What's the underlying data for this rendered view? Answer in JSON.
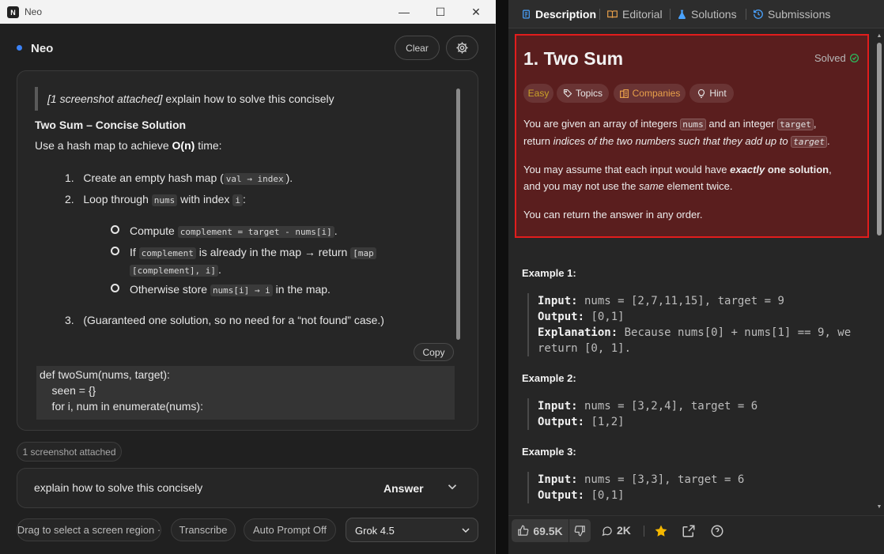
{
  "window": {
    "app_icon_letter": "N",
    "title": "Neo",
    "minimize_glyph": "—",
    "maximize_glyph": "☐",
    "close_glyph": "✕"
  },
  "header": {
    "title": "Neo",
    "clear_label": "Clear",
    "settings_icon": "gear-icon"
  },
  "chat": {
    "prompt_prefix": "[1 screenshot attached]",
    "prompt_text": " explain how to solve this concisely",
    "solution_title": "Two Sum – Concise Solution",
    "intro_pre": "Use a hash map to achieve ",
    "intro_bold": "O(n)",
    "intro_post": " time:",
    "step1_num": "1.",
    "step1_pre": "Create an empty hash map (",
    "step1_code": "val → index",
    "step1_post": ").",
    "step2_num": "2.",
    "step2_pre": "Loop through ",
    "step2_code1": "nums",
    "step2_mid": " with index ",
    "step2_code2": "i",
    "step2_post": ":",
    "sub1_pre": "Compute ",
    "sub1_code": "complement = target - nums[i]",
    "sub1_post": ".",
    "sub2_pre": "If ",
    "sub2_code1": "complement",
    "sub2_mid": " is already in the map → return ",
    "sub2_code2a": "[map",
    "sub2_code2b": "[complement], i]",
    "sub2_post": ".",
    "sub3_pre": "Otherwise store ",
    "sub3_code": "nums[i] → i",
    "sub3_post": " in the map.",
    "step3_num": "3.",
    "step3_text": "(Guaranteed one solution, so no need for a “not found” case.)",
    "copy_label": "Copy",
    "code_lines": [
      "def twoSum(nums, target):",
      "    seen = {}",
      "    for i, num in enumerate(nums):"
    ]
  },
  "attachment_chip": "1 screenshot attached",
  "input": {
    "value": "explain how to solve this concisely",
    "mode_label": "Answer"
  },
  "toolbar": {
    "drag_label": "Drag to select a screen region ·",
    "transcribe_label": "Transcribe",
    "auto_prompt_label": "Auto Prompt Off",
    "model_label": "Grok 4.5"
  },
  "leetcode": {
    "tabs": [
      "Description",
      "Editorial",
      "Solutions",
      "Submissions"
    ],
    "problem_title": "1. Two Sum",
    "solved_label": "Solved",
    "tags": [
      "Easy",
      "Topics",
      "Companies",
      "Hint"
    ],
    "p1": {
      "a": "You are given an array of integers ",
      "code1": "nums",
      "b": " and an integer ",
      "code2": "target",
      "c": ",",
      "d": "return ",
      "italic": "indices of the two numbers such that they add up to",
      "e": " ",
      "code3": "target",
      "f": "."
    },
    "p2": {
      "a": "You may assume that each input would have ",
      "boldital": "exactly",
      "bold": " one solution",
      "b": ",",
      "c": "and you may not use the ",
      "ital": "same",
      "d": " element twice."
    },
    "p3": "You can return the answer in any order.",
    "examples": [
      {
        "title": "Example 1:",
        "input_label": "Input:",
        "input": " nums = [2,7,11,15], target = 9",
        "output_label": "Output:",
        "output": " [0,1]",
        "expl_label": "Explanation:",
        "expl1": " Because nums[0] + nums[1] == 9, we",
        "expl2": "return [0, 1]."
      },
      {
        "title": "Example 2:",
        "input_label": "Input:",
        "input": " nums = [3,2,4], target = 6",
        "output_label": "Output:",
        "output": " [1,2]"
      },
      {
        "title": "Example 3:",
        "input_label": "Input:",
        "input": " nums = [3,3], target = 6",
        "output_label": "Output:",
        "output": " [0,1]"
      }
    ],
    "footer": {
      "likes": "69.5K",
      "comments": "2K"
    },
    "colors": {
      "highlight_border": "#e11d1d",
      "highlight_bg": "#5a1e1e",
      "easy": "#c9a227",
      "companies": "#e8a04a",
      "solved_check": "#2cbb5d",
      "star": "#f5b800"
    }
  }
}
